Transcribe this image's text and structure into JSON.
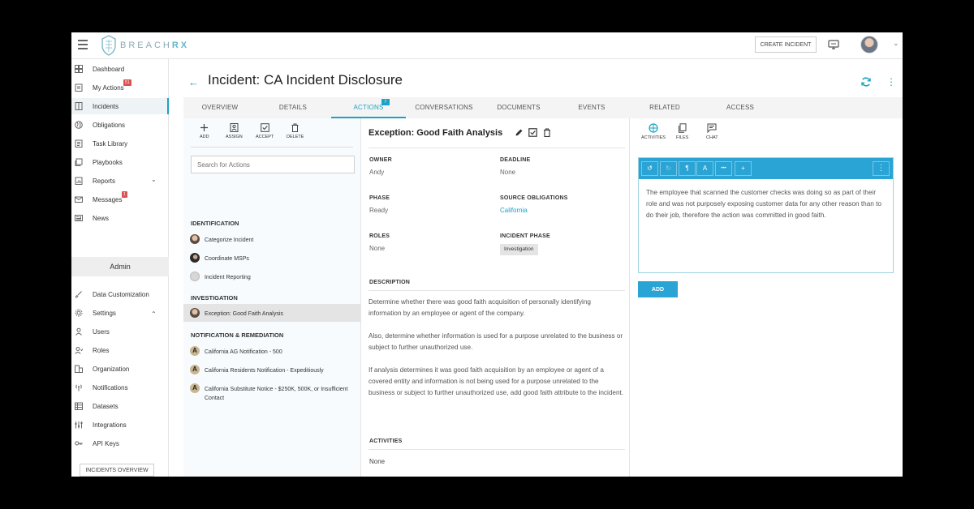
{
  "brand": {
    "logo_main": "BREACH",
    "logo_accent": "RX"
  },
  "topbar": {
    "create_incident_label": "CREATE INCIDENT"
  },
  "sidebar": {
    "items": [
      {
        "label": "Dashboard",
        "icon": "dashboard-icon"
      },
      {
        "label": "My Actions",
        "icon": "clipboard-icon",
        "badge": "51"
      },
      {
        "label": "Incidents",
        "icon": "incidents-icon",
        "active": true
      },
      {
        "label": "Obligations",
        "icon": "globe-icon"
      },
      {
        "label": "Task Library",
        "icon": "task-library-icon"
      },
      {
        "label": "Playbooks",
        "icon": "playbooks-icon"
      },
      {
        "label": "Reports",
        "icon": "reports-icon",
        "chevron": "down"
      },
      {
        "label": "Messages",
        "icon": "mail-icon",
        "badge": "1"
      },
      {
        "label": "News",
        "icon": "news-icon"
      }
    ],
    "admin_header": "Admin",
    "admin_items": [
      {
        "label": "Data Customization",
        "icon": "brush-icon"
      },
      {
        "label": "Settings",
        "icon": "gear-icon",
        "chevron": "up"
      },
      {
        "label": "Users",
        "icon": "user-icon"
      },
      {
        "label": "Roles",
        "icon": "roles-icon"
      },
      {
        "label": "Organization",
        "icon": "organization-icon"
      },
      {
        "label": "Notifications",
        "icon": "broadcast-icon"
      },
      {
        "label": "Datasets",
        "icon": "datasets-icon"
      },
      {
        "label": "Integrations",
        "icon": "integrations-icon"
      },
      {
        "label": "API Keys",
        "icon": "key-icon"
      }
    ],
    "incidents_overview_label": "INCIDENTS OVERVIEW"
  },
  "page": {
    "title": "Incident: CA Incident Disclosure"
  },
  "tabs": [
    {
      "label": "OVERVIEW"
    },
    {
      "label": "DETAILS"
    },
    {
      "label": "ACTIONS",
      "active": true,
      "badge": "7"
    },
    {
      "label": "CONVERSATIONS"
    },
    {
      "label": "DOCUMENTS"
    },
    {
      "label": "EVENTS"
    },
    {
      "label": "RELATED"
    },
    {
      "label": "ACCESS"
    }
  ],
  "actions_panel": {
    "tools": [
      "ADD",
      "ASSIGN",
      "ACCEPT",
      "DELETE"
    ],
    "search_placeholder": "Search for Actions",
    "sections": [
      {
        "title": "IDENTIFICATION",
        "items": [
          {
            "label": "Categorize Incident",
            "avatar": "photo"
          },
          {
            "label": "Coordinate MSPs",
            "avatar": "dark"
          },
          {
            "label": "Incident Reporting",
            "avatar": "gray"
          }
        ]
      },
      {
        "title": "INVESTIGATION",
        "items": [
          {
            "label": "Exception: Good Faith Analysis",
            "avatar": "photo",
            "active": true
          }
        ]
      },
      {
        "title": "NOTIFICATION & REMEDIATION",
        "items": [
          {
            "label": "California AG Notification - 500",
            "avatar": "A"
          },
          {
            "label": "California Residents Notification - Expeditiously",
            "avatar": "A"
          },
          {
            "label": "California Substitute Notice - $250K, 500K, or Insufficient Contact",
            "avatar": "A"
          }
        ]
      }
    ]
  },
  "details": {
    "title": "Exception: Good Faith Analysis",
    "owner_label": "OWNER",
    "owner_value": "Andy",
    "deadline_label": "DEADLINE",
    "deadline_value": "None",
    "phase_label": "PHASE",
    "phase_value": "Ready",
    "source_label": "SOURCE OBLIGATIONS",
    "source_value": "California",
    "roles_label": "ROLES",
    "roles_value": "None",
    "incident_phase_label": "INCIDENT PHASE",
    "incident_phase_value": "Investigation",
    "description_label": "DESCRIPTION",
    "description_paragraphs": [
      "Determine whether there was good faith acquisition of personally identifying information by an employee or agent of the company.",
      "Also, determine whether information is used for a purpose unrelated to the business or subject to further unauthorized use.",
      "If analysis determines it was good faith acquisition by an employee or agent of a covered entity and information is not being used for a purpose unrelated to the business or subject to further unauthorized use, add good faith attribute to the incident."
    ],
    "activities_label": "ACTIVITIES",
    "activities_value": "None"
  },
  "right_panel": {
    "tabs": [
      "ACTIVITIES",
      "FILES",
      "CHAT"
    ],
    "toolbar": [
      "undo",
      "redo",
      "paragraph",
      "text-size",
      "more",
      "insert"
    ],
    "toolbar_glyphs": [
      "↺",
      "↻",
      "¶",
      "A",
      "•••",
      "+"
    ],
    "editor_text": "The employee that scanned the customer checks was doing so as part of their role and was not purposely exposing customer data for any other reason than to do their job, therefore the action was committed in good faith.",
    "add_label": "ADD"
  },
  "colors": {
    "accent": "#1aa3c4",
    "toolbar_blue": "#2aa4d5",
    "badge_red": "#d9534f"
  }
}
